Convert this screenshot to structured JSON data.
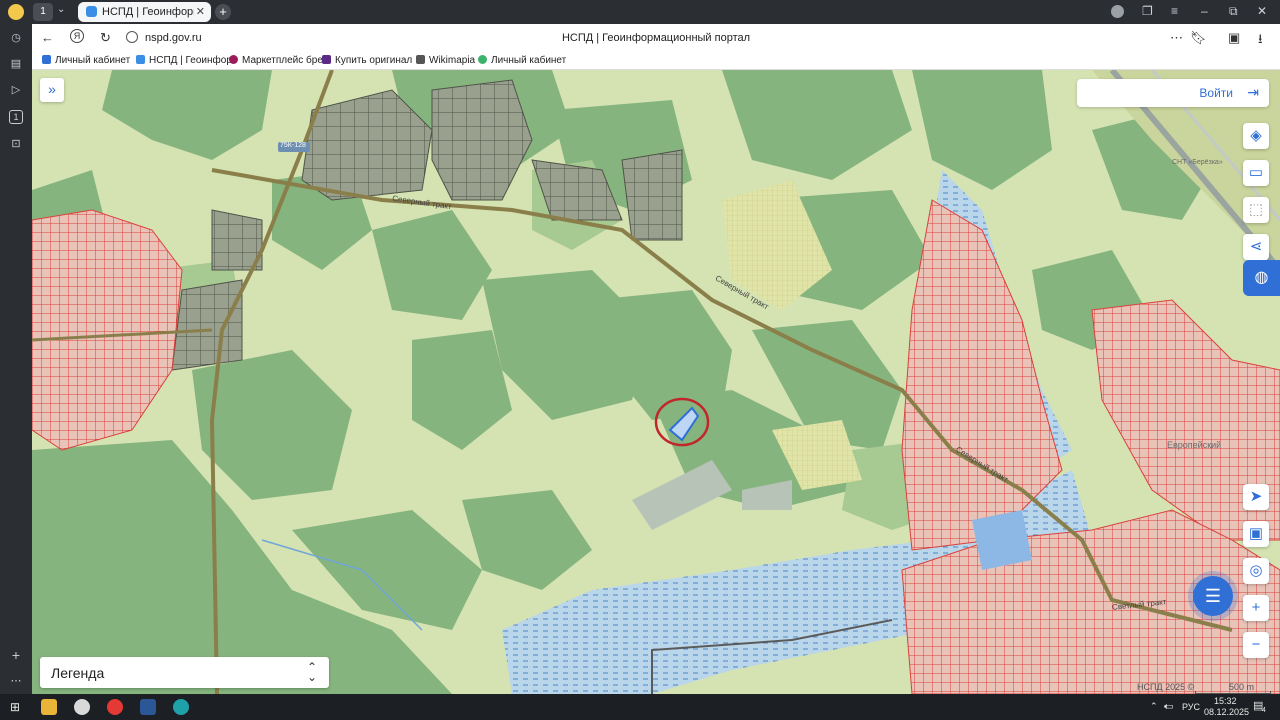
{
  "browser": {
    "tab_count": "1",
    "active_tab_title": "НСПД | Геоинформационный портал",
    "url": "nspd.gov.ru",
    "page_title": "НСПД | Геоинформационный портал",
    "bookmarks": [
      {
        "label": "Личный кабинет",
        "color": "#2f6fd6"
      },
      {
        "label": "НСПД | Геоинфор",
        "color": "#3a8ee6"
      },
      {
        "label": "Маркетплейс бре",
        "color": "#9b1b5a"
      },
      {
        "label": "Купить оригинал",
        "color": "#5b2a86"
      },
      {
        "label": "Wikimapia",
        "color": "#555555"
      },
      {
        "label": "Личный кабинет",
        "color": "#3db26b"
      }
    ],
    "sidebar_icons": [
      "clock-icon",
      "notes-icon",
      "play-icon",
      "tab-count-icon",
      "media-icon",
      "add-icon",
      "more-icon"
    ],
    "sidebar_badge": "1"
  },
  "map": {
    "login_label": "Войти",
    "legend_label": "Легенда",
    "copyright": "НСПД 2025 ©",
    "scale": "500 m",
    "road_labels": [
      "Северный тракт",
      "Северный тракт",
      "Светлый тракт",
      "Европейский"
    ],
    "road_sign": "75К-128",
    "settlement_label": "СНТ «Берёзка»",
    "controls_top": [
      "layers-icon",
      "ruler-icon",
      "select-area-icon",
      "share-icon"
    ],
    "controls_bottom": [
      "locate-icon",
      "screen-icon",
      "geopoint-icon",
      "zoom-in-icon",
      "zoom-out-icon"
    ]
  },
  "taskbar": {
    "language": "РУС",
    "time": "15:32",
    "date": "08.12.2025",
    "notification_count": "4"
  },
  "colors": {
    "accent": "#2f6fd6",
    "forest": "#7fb07a",
    "field": "#d6e4b4",
    "plots_red": "#d9413b",
    "marker_red": "#c0262a"
  }
}
